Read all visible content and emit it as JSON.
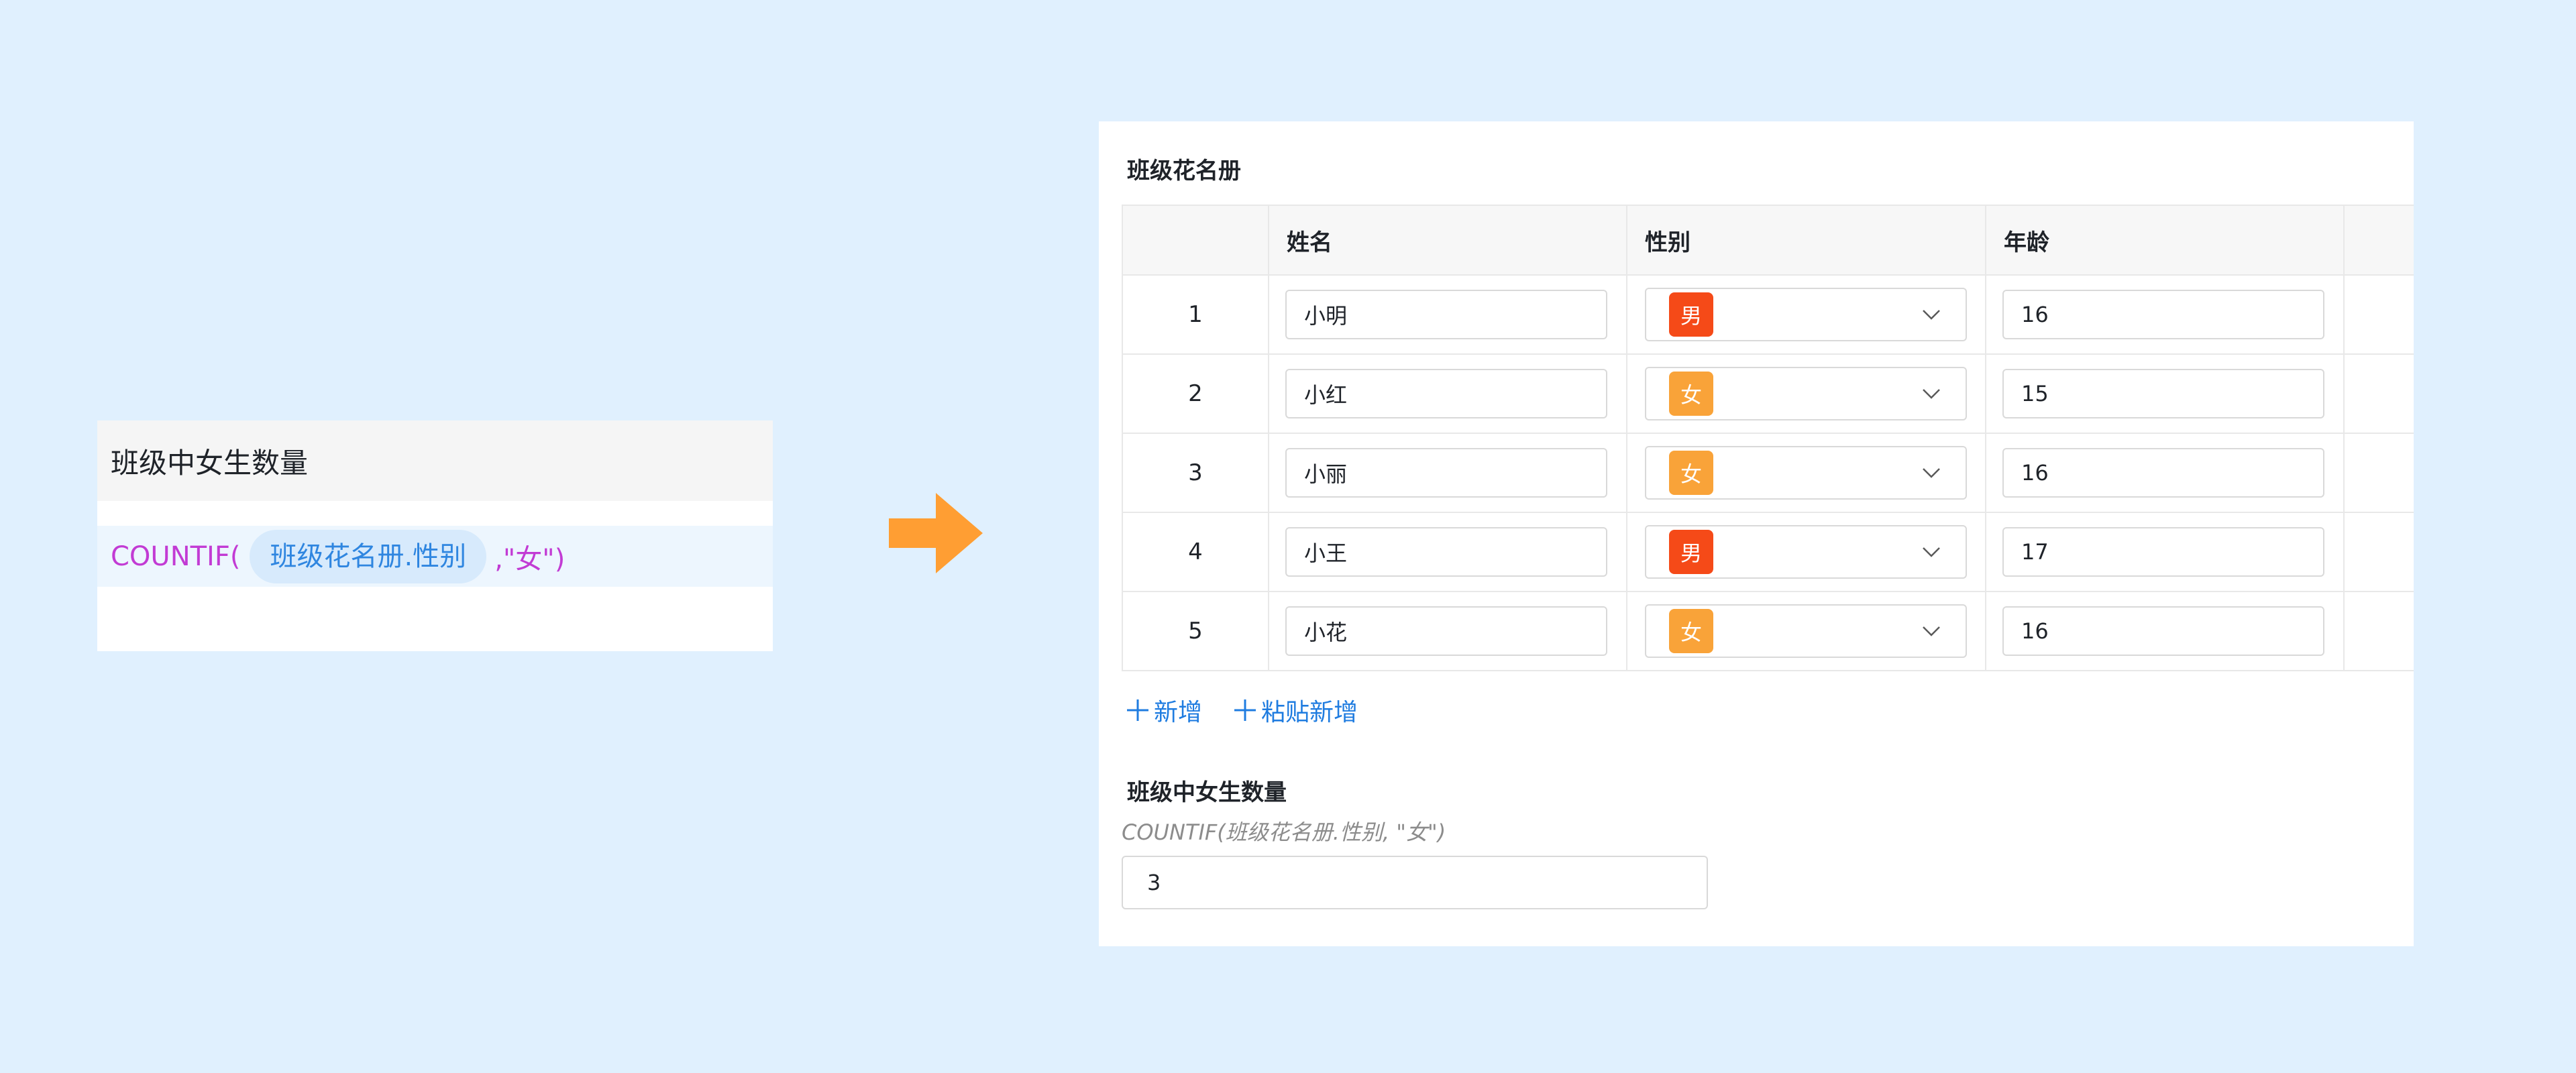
{
  "formula_panel": {
    "title": "班级中女生数量",
    "fn": "COUNTIF(",
    "ref": "班级花名册.性别",
    "arg": ",\"女\")"
  },
  "form": {
    "table_title": "班级花名册",
    "columns": [
      "",
      "姓名",
      "性别",
      "年龄"
    ],
    "rows": [
      {
        "idx": "1",
        "name": "小明",
        "gender": "男",
        "age": "16"
      },
      {
        "idx": "2",
        "name": "小红",
        "gender": "女",
        "age": "15"
      },
      {
        "idx": "3",
        "name": "小丽",
        "gender": "女",
        "age": "16"
      },
      {
        "idx": "4",
        "name": "小王",
        "gender": "男",
        "age": "17"
      },
      {
        "idx": "5",
        "name": "小花",
        "gender": "女",
        "age": "16"
      }
    ],
    "add_label": "新增",
    "paste_add_label": "粘贴新增",
    "calc_title": "班级中女生数量",
    "calc_formula": "COUNTIF(班级花名册.性别, \"女\")",
    "calc_value": "3"
  },
  "colors": {
    "background": "#e0f0fe",
    "male_tag": "#f54a18",
    "female_tag": "#f9a339",
    "arrow": "#ff9e33",
    "link": "#1f7ce0"
  },
  "icons": {
    "arrow": "arrow-right-icon",
    "dropdown": "chevron-down-icon",
    "add": "plus-icon"
  }
}
